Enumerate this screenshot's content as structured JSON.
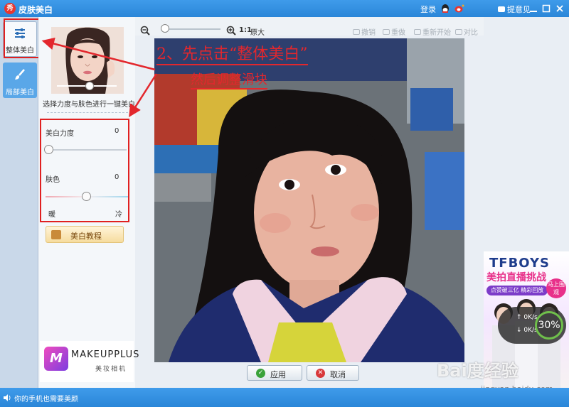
{
  "app": {
    "title": "皮肤美白",
    "logo_text": "秀",
    "login": "登录",
    "feedback": "提意见"
  },
  "tabs": [
    {
      "label": "整体美白",
      "icon": "sliders-icon",
      "active": true
    },
    {
      "label": "局部美白",
      "icon": "brush-icon",
      "active": false
    }
  ],
  "panel": {
    "description": "选择力度与肤色进行一键美白",
    "preset_level": 0.55,
    "whitening": {
      "label": "美白力度",
      "value": "0"
    },
    "skin_tone": {
      "label": "肤色",
      "value": "0",
      "left_label": "暖",
      "right_label": "冷"
    },
    "tutorial_label": "美白教程"
  },
  "toolbar": {
    "ratio": "1:1",
    "original": "原大",
    "undo": "撤销",
    "redo": "重做",
    "restart": "重新开始",
    "compare": "对比"
  },
  "annotation": {
    "line1": "2、先点击“整体美白”",
    "line2": "然后调整滑块",
    "color": "#e3272d"
  },
  "actions": {
    "apply": "应用",
    "cancel": "取消"
  },
  "ad_makeup": {
    "logo": "M",
    "name": "MAKEUPPLUS",
    "sub": "美妆相机"
  },
  "ad_right": {
    "headline": "TFBOYS",
    "title": "美拍直播挑战",
    "subtitle": "点赞破三亿 精彩回放",
    "badge": "马上围观"
  },
  "net_speed": {
    "up": "0K/s",
    "down": "0K/s",
    "percent": "30%"
  },
  "watermark": {
    "main": "Bai度经验",
    "sub": "jingyan.baidu.com"
  },
  "status": {
    "text": "你的手机也需要美颜"
  },
  "colors": {
    "title_bar": "#2a86d8",
    "highlight": "#e02020",
    "accent_tab": "#5aa7e8"
  }
}
